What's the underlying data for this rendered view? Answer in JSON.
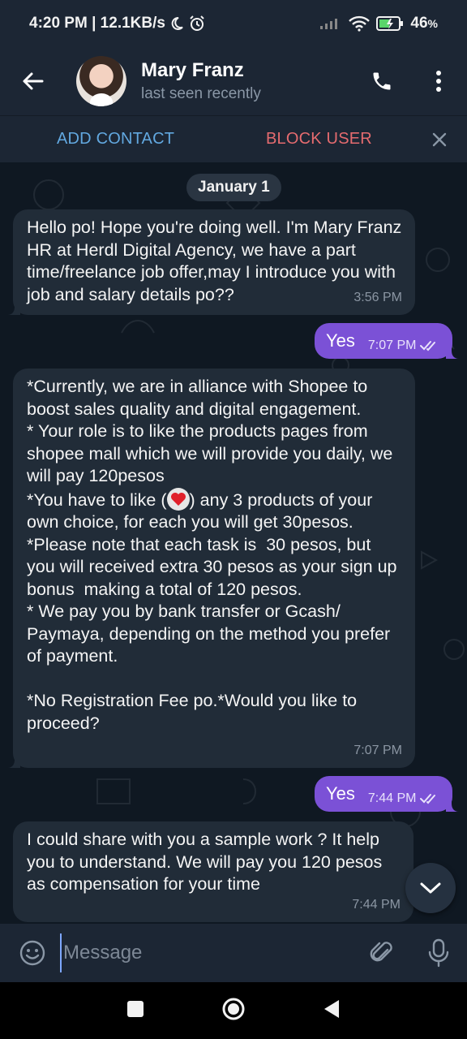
{
  "status_bar": {
    "time_speed": "4:20 PM | 12.1KB/s",
    "battery_percent": "46",
    "battery_suffix": "%"
  },
  "header": {
    "contact_name": "Mary Franz",
    "contact_status": "last seen recently"
  },
  "action_bar": {
    "add_contact": "ADD CONTACT",
    "block_user": "BLOCK USER"
  },
  "chat": {
    "date": "January 1",
    "messages": [
      {
        "direction": "in",
        "text": "Hello po! Hope you're doing well. I'm Mary Franz HR at Herdl Digital Agency, we have a part time/freelance job offer,may I introduce you with job and salary details po??",
        "time": "3:56 PM"
      },
      {
        "direction": "out",
        "text": "Yes",
        "time": "7:07 PM",
        "read": true
      },
      {
        "direction": "in",
        "text_part1": "*Currently, we are in alliance with Shopee to boost sales quality and digital engagement.\n* Your role is to like the products pages from shopee mall which we will provide you daily, we will pay 120pesos\n*You have to like (",
        "text_part2": ") any 3 products of your own choice, for each you will get 30pesos.\n*Please note that each task is  30 pesos, but you will received extra 30 pesos as your sign up bonus  making a total of 120 pesos.\n* We pay you by bank transfer or Gcash/ Paymaya, depending on the method you prefer of payment.\n\n*No Registration Fee po.*Would you like to proceed?",
        "time": "7:07 PM"
      },
      {
        "direction": "out",
        "text": "Yes",
        "time": "7:44 PM",
        "read": true
      },
      {
        "direction": "in",
        "text": "I could share with you a sample work ? It help you to understand. We will pay you 120 pesos as compensation for your time",
        "time": "7:44 PM"
      }
    ]
  },
  "input": {
    "placeholder": "Message"
  },
  "colors": {
    "outgoing_bubble": "#7b51d6",
    "incoming_bubble": "#212c38",
    "add_contact": "#62a8e0",
    "block_user": "#e56b6f"
  },
  "icons": {
    "back": "back-arrow-icon",
    "call": "phone-icon",
    "menu": "more-vert-icon",
    "close": "close-icon",
    "emoji": "emoji-icon",
    "attach": "paperclip-icon",
    "mic": "microphone-icon",
    "scroll": "chevron-down-icon",
    "nav_recents": "square-icon",
    "nav_home": "circle-icon",
    "nav_back": "triangle-back-icon"
  }
}
